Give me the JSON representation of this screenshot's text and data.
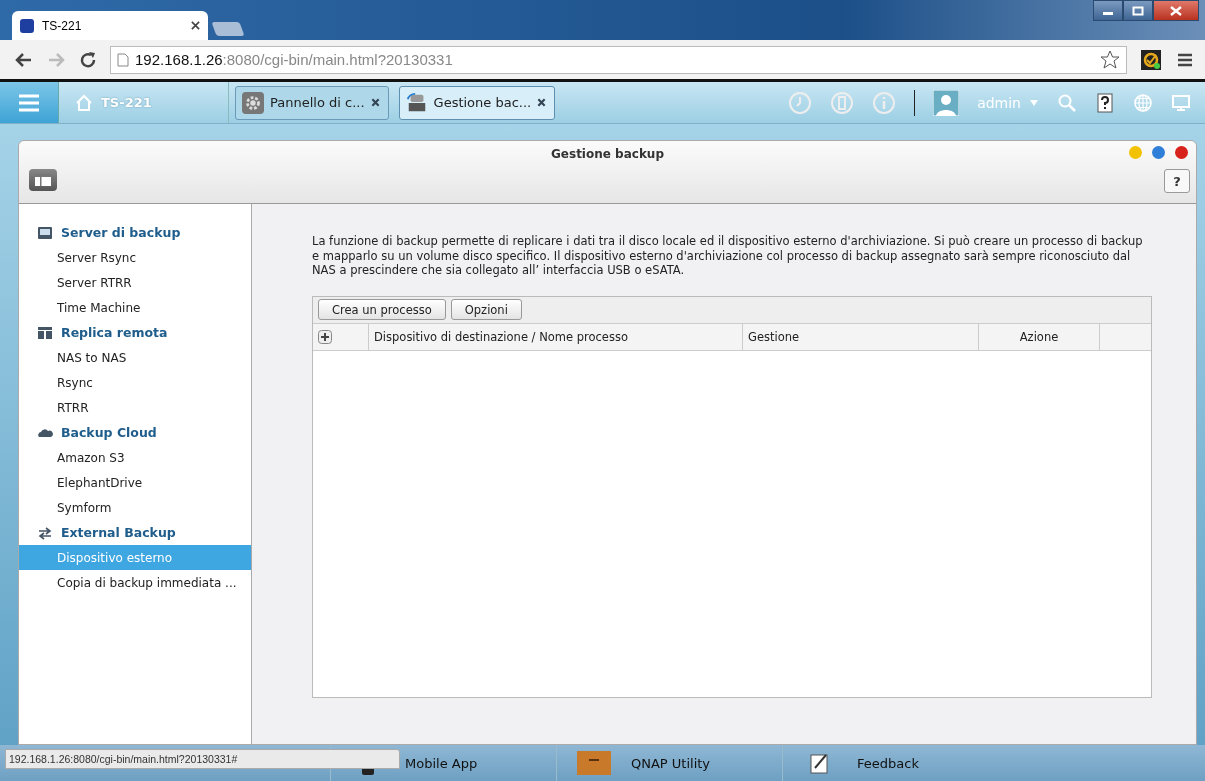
{
  "browser": {
    "tab_title": "TS-221",
    "address_host": "192.168.1.26",
    "address_rest": ":8080/cgi-bin/main.html?20130331"
  },
  "topbar": {
    "home_label": "TS-221",
    "app_tabs": [
      {
        "label": "Pannello di c...",
        "kind": "gear",
        "selected": false
      },
      {
        "label": "Gestione bac...",
        "kind": "backup",
        "selected": true
      }
    ],
    "user": "admin"
  },
  "window": {
    "title": "Gestione backup",
    "help": "?"
  },
  "sidebar": [
    {
      "kind": "server",
      "label": "Server di backup",
      "children": [
        {
          "label": "Server Rsync",
          "selected": false
        },
        {
          "label": "Server RTRR",
          "selected": false
        },
        {
          "label": "Time Machine",
          "selected": false
        }
      ]
    },
    {
      "kind": "replica",
      "label": "Replica remota",
      "children": [
        {
          "label": "NAS to NAS",
          "selected": false
        },
        {
          "label": "Rsync",
          "selected": false
        },
        {
          "label": "RTRR",
          "selected": false
        }
      ]
    },
    {
      "kind": "cloud",
      "label": "Backup Cloud",
      "children": [
        {
          "label": "Amazon S3",
          "selected": false
        },
        {
          "label": "ElephantDrive",
          "selected": false
        },
        {
          "label": "Symform",
          "selected": false
        }
      ]
    },
    {
      "kind": "sync",
      "label": "External Backup",
      "children": [
        {
          "label": "Dispositivo esterno",
          "selected": true
        },
        {
          "label": "Copia di backup immediata ...",
          "selected": false
        }
      ]
    }
  ],
  "description": "La funzione di backup permette di replicare i dati tra il disco locale ed il dispositivo esterno d'archiviazione. Si può creare un processo di backup e mapparlo su un volume disco specifico. Il dispositivo esterno d'archiviazione col processo di backup assegnato sarà sempre riconosciuto dal NAS a prescindere che sia collegato all’  interfaccia USB o eSATA.",
  "toolbar_buttons": [
    "Crea un processo",
    "Opzioni"
  ],
  "table": {
    "columns": [
      "Dispositivo di destinazione / Nome processo",
      "Gestione",
      "Azione"
    ]
  },
  "dock": [
    {
      "label": "Mobile App",
      "kind": "phone"
    },
    {
      "label": "QNAP Utility",
      "kind": "box"
    },
    {
      "label": "Feedback",
      "kind": "pen"
    }
  ],
  "status_url": "192.168.1.26:8080/cgi-bin/main.html?20130331#"
}
